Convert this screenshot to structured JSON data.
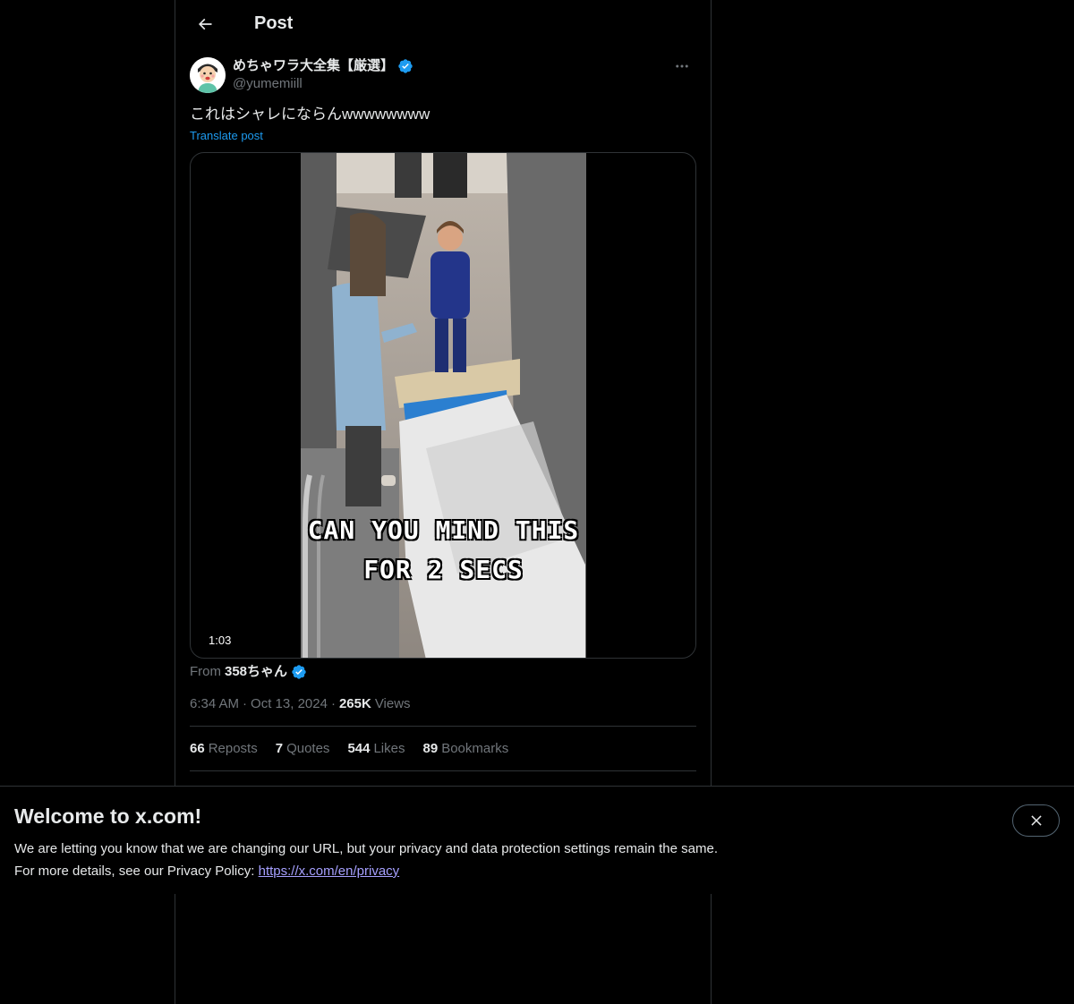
{
  "header": {
    "title": "Post"
  },
  "post": {
    "author_name": "めちゃワラ大全集【厳選】",
    "author_handle": "@yumemiill",
    "text": "これはシャレにならんwwwwwwww",
    "translate_label": "Translate post",
    "media": {
      "caption_line1": "CAN YOU MIND THIS",
      "caption_line2": "FOR 2 SECS",
      "duration": "1:03"
    },
    "from_label": "From",
    "from_name": "358ちゃん",
    "time": "6:34 AM",
    "date": "Oct 13, 2024",
    "separator": "·",
    "views_count": "265K",
    "views_label": "Views",
    "stats": [
      {
        "count": "66",
        "label": "Reposts"
      },
      {
        "count": "7",
        "label": "Quotes"
      },
      {
        "count": "544",
        "label": "Likes"
      },
      {
        "count": "89",
        "label": "Bookmarks"
      }
    ]
  },
  "banner": {
    "title": "Welcome to x.com!",
    "line1": "We are letting you know that we are changing our URL, but your privacy and data protection settings remain the same.",
    "line2_prefix": "For more details, see our Privacy Policy:",
    "link": "https://x.com/en/privacy"
  },
  "colors": {
    "background": "#000000",
    "text_primary": "#e7e9ea",
    "text_secondary": "#71767b",
    "accent": "#1d9bf0",
    "border": "#2f3336",
    "verified": "#1d9bf0"
  },
  "icons": [
    "back-arrow-icon",
    "verified-badge-icon",
    "more-icon",
    "close-icon"
  ]
}
